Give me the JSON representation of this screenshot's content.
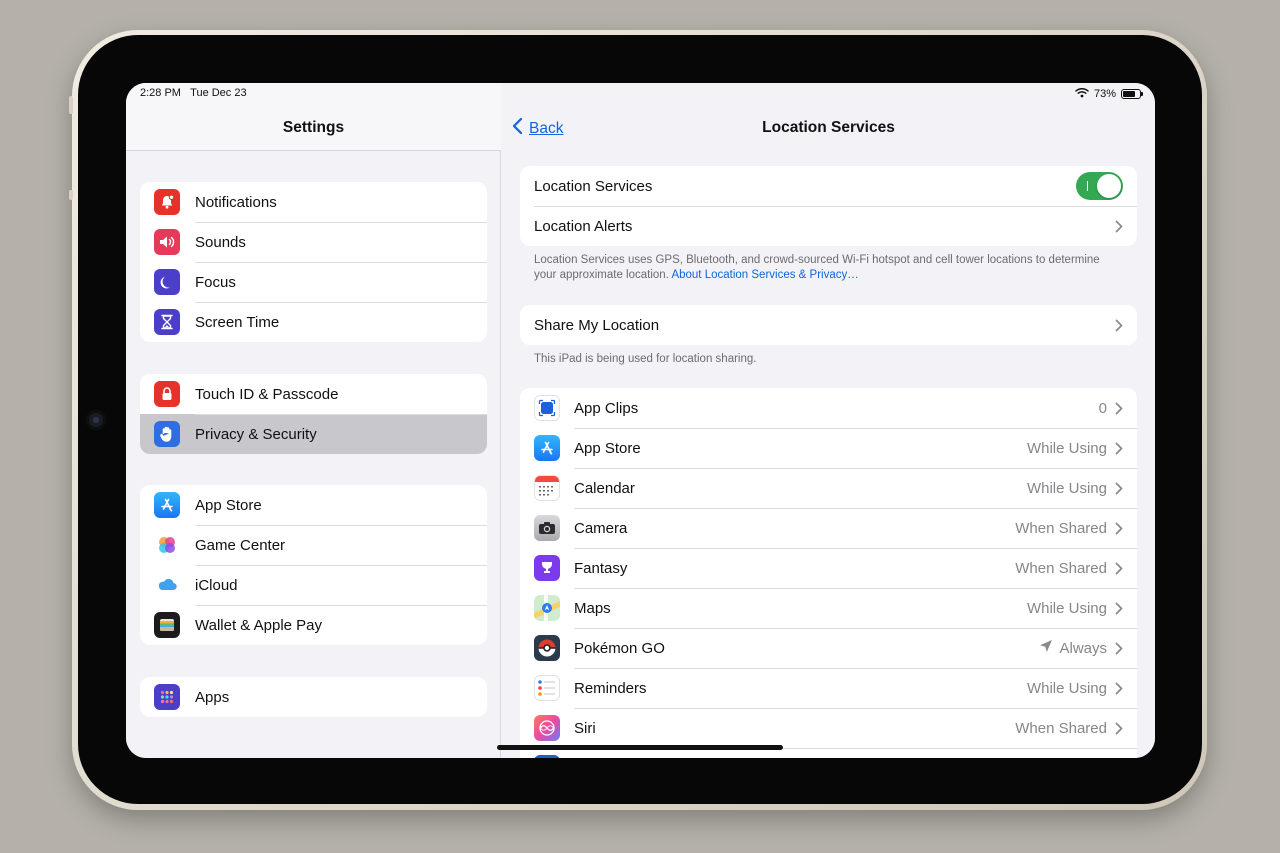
{
  "status": {
    "time": "2:28 PM",
    "date": "Tue Dec 23",
    "battery": "73%",
    "battery_level": 0.73
  },
  "sidebar": {
    "title": "Settings",
    "groups": [
      {
        "items": [
          {
            "label": "Notifications",
            "icon": "bell-badge-icon",
            "color": "#e5332a"
          },
          {
            "label": "Sounds",
            "icon": "speaker-icon",
            "color": "#e53b5a"
          },
          {
            "label": "Focus",
            "icon": "moon-icon",
            "color": "#4b3fc9"
          },
          {
            "label": "Screen Time",
            "icon": "hourglass-icon",
            "color": "#4b3fc9"
          }
        ]
      },
      {
        "items": [
          {
            "label": "Touch ID & Passcode",
            "icon": "lock-icon",
            "color": "#e5332a"
          },
          {
            "label": "Privacy & Security",
            "icon": "hand-icon",
            "color": "#2f6ee0",
            "selected": true
          }
        ]
      },
      {
        "items": [
          {
            "label": "App Store",
            "icon": "app-store-icon",
            "color": "#1e8ef5"
          },
          {
            "label": "Game Center",
            "icon": "game-center-icon",
            "color": "#ffffff"
          },
          {
            "label": "iCloud",
            "icon": "cloud-icon",
            "color": "#ffffff"
          },
          {
            "label": "Wallet & Apple Pay",
            "icon": "wallet-icon",
            "color": "#1c1c1e"
          }
        ]
      },
      {
        "items": [
          {
            "label": "Apps",
            "icon": "apps-grid-icon",
            "color": "#4b3fc9"
          }
        ]
      }
    ]
  },
  "detail": {
    "back_label": "Back",
    "title": "Location Services",
    "location_services_label": "Location Services",
    "location_services_on": true,
    "location_alerts_label": "Location Alerts",
    "footnote_text": "Location Services uses GPS, Bluetooth, and crowd-sourced Wi-Fi hotspot and cell tower locations to determine your approximate location.",
    "footnote_link": "About Location Services & Privacy…",
    "share_label": "Share My Location",
    "share_note": "This iPad is being used for location sharing.",
    "apps": [
      {
        "name": "App Clips",
        "value": "0",
        "icon": "app-clips-icon"
      },
      {
        "name": "App Store",
        "value": "While Using",
        "icon": "app-store-icon"
      },
      {
        "name": "Calendar",
        "value": "While Using",
        "icon": "calendar-icon"
      },
      {
        "name": "Camera",
        "value": "When Shared",
        "icon": "camera-icon"
      },
      {
        "name": "Fantasy",
        "value": "When Shared",
        "icon": "fantasy-icon"
      },
      {
        "name": "Maps",
        "value": "While Using",
        "icon": "maps-icon"
      },
      {
        "name": "Pokémon GO",
        "value": "Always",
        "icon": "pokeball-icon",
        "arrow": true
      },
      {
        "name": "Reminders",
        "value": "While Using",
        "icon": "reminders-icon"
      },
      {
        "name": "Siri",
        "value": "When Shared",
        "icon": "siri-icon"
      }
    ]
  }
}
